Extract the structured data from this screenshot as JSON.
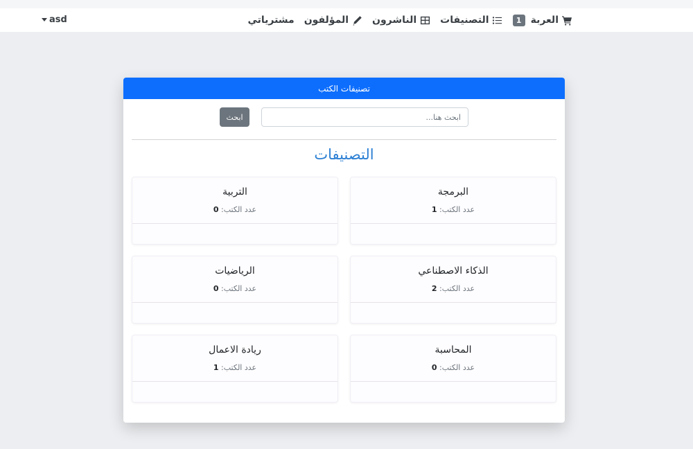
{
  "navbar": {
    "cart_label": "العربة",
    "cart_count": "1",
    "categories_label": "التصنيفات",
    "publishers_label": "الناشرون",
    "authors_label": "المؤلفون",
    "purchases_label": "مشترياتي",
    "user_label": "asd"
  },
  "card": {
    "header": "تصنيفات الكتب",
    "search_placeholder": "ابحث هنا...",
    "search_button": "ابحث",
    "section_title": "التصنيفات"
  },
  "categories": [
    {
      "name": "البرمجة",
      "count_label": "عدد الكتب:",
      "count": "1"
    },
    {
      "name": "التربية",
      "count_label": "عدد الكتب:",
      "count": "0"
    },
    {
      "name": "الذكاء الاصطناعي",
      "count_label": "عدد الكتب:",
      "count": "2"
    },
    {
      "name": "الرياضيات",
      "count_label": "عدد الكتب:",
      "count": "0"
    },
    {
      "name": "المحاسبة",
      "count_label": "عدد الكتب:",
      "count": "0"
    },
    {
      "name": "ريادة الاعمال",
      "count_label": "عدد الكتب:",
      "count": "1"
    }
  ]
}
